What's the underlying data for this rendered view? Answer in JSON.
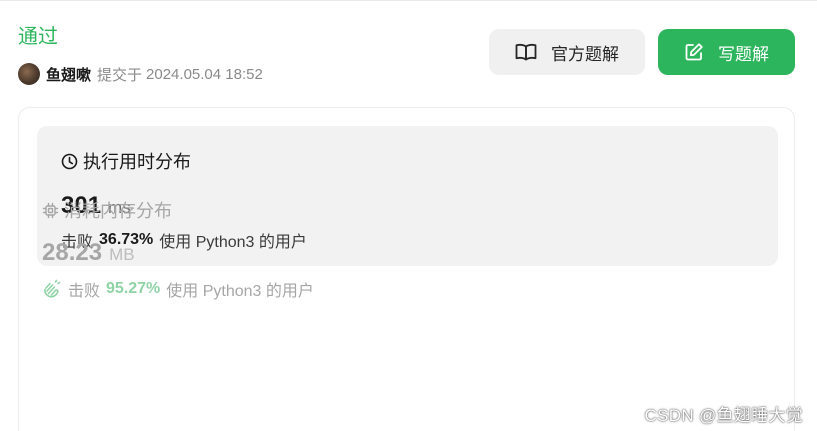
{
  "submission": {
    "status": "通过",
    "username": "鱼翅嗽",
    "submitted_label": "提交于",
    "submitted_at": "2024.05.04 18:52"
  },
  "toolbar": {
    "official_solution_label": "官方题解",
    "write_solution_label": "写题解"
  },
  "runtime": {
    "title": "执行用时分布",
    "value": "301",
    "unit": "ms",
    "beats_label": "击败",
    "beats_pct": "36.73%",
    "beats_suffix": "使用 Python3 的用户"
  },
  "memory": {
    "title": "消耗内存分布",
    "value": "28.23",
    "unit": "MB",
    "beats_label": "击败",
    "beats_pct": "95.27%",
    "beats_suffix": "使用 Python3 的用户"
  },
  "watermark": "CSDN @鱼翅睡大觉",
  "colors": {
    "accent": "#2db55d",
    "accent_light": "#8fd3a6",
    "card_bg": "#f2f2f2",
    "button_bg": "#f0f0f0"
  },
  "icons": {
    "avatar": "user-avatar",
    "official_solution": "book-open-icon",
    "write_solution": "edit-icon",
    "runtime": "clock-icon",
    "memory": "chip-icon",
    "beats_memory": "clap-hands-icon"
  }
}
